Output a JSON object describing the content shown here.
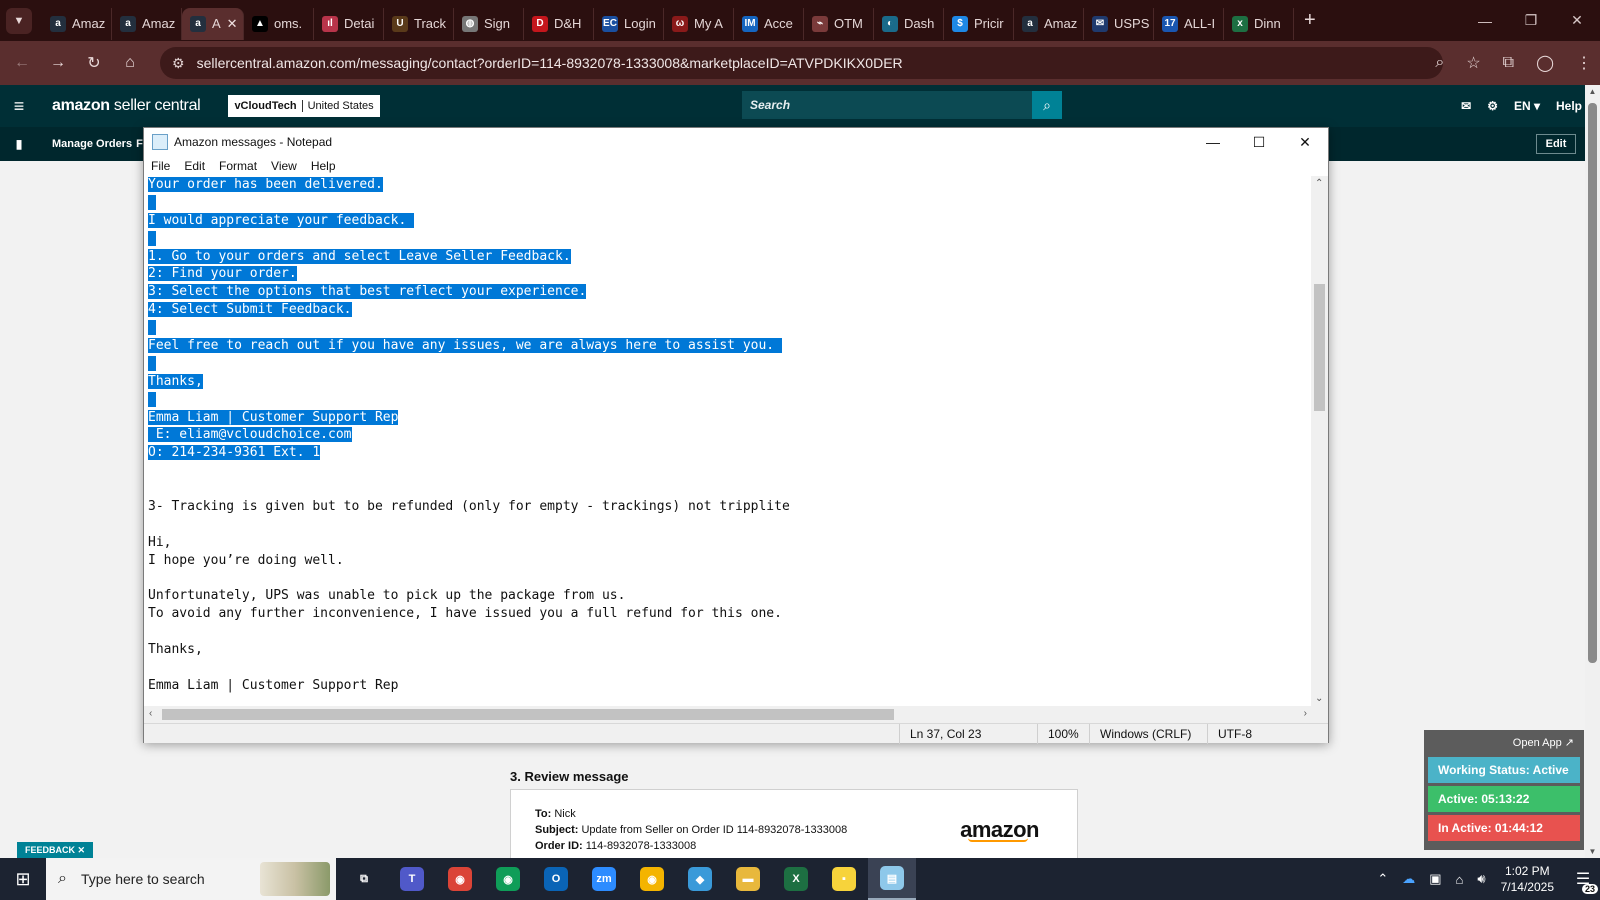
{
  "browser": {
    "tabs": [
      {
        "label": "Amaz",
        "icon": "amazon-icon",
        "color": "#232f3e",
        "glyph": "a"
      },
      {
        "label": "Amaz",
        "icon": "amazon-icon",
        "color": "#232f3e",
        "glyph": "a"
      },
      {
        "label": "A",
        "icon": "amazon-icon",
        "color": "#232f3e",
        "glyph": "a",
        "active": true
      },
      {
        "label": "oms.",
        "icon": "triangle-icon",
        "color": "#000000",
        "glyph": "▲"
      },
      {
        "label": "Detai",
        "icon": "dh-icon",
        "color": "#b8344a",
        "glyph": "ıl"
      },
      {
        "label": "Track",
        "icon": "ups-icon",
        "color": "#5a3a1a",
        "glyph": "U"
      },
      {
        "label": "Sign",
        "icon": "globe-icon",
        "color": "#777777",
        "glyph": "◍"
      },
      {
        "label": "D&H",
        "icon": "dh-logo-icon",
        "color": "#c4161c",
        "glyph": "D"
      },
      {
        "label": "Login",
        "icon": "ec-icon",
        "color": "#1a4fa0",
        "glyph": "EC"
      },
      {
        "label": "My A",
        "icon": "myapp-icon",
        "color": "#8a1a1a",
        "glyph": "ω"
      },
      {
        "label": "Acce",
        "icon": "im-icon",
        "color": "#1565c0",
        "glyph": "IM"
      },
      {
        "label": "OTM",
        "icon": "otm-icon",
        "color": "#7a3a3a",
        "glyph": "⌁"
      },
      {
        "label": "Dash",
        "icon": "dash-icon",
        "color": "#1a6a8a",
        "glyph": "◐"
      },
      {
        "label": "Pricir",
        "icon": "dollar-icon",
        "color": "#1e88e5",
        "glyph": "$"
      },
      {
        "label": "Amaz",
        "icon": "amazon-icon",
        "color": "#232f3e",
        "glyph": "a"
      },
      {
        "label": "USPS",
        "icon": "usps-icon",
        "color": "#1f3a6e",
        "glyph": "✉"
      },
      {
        "label": "ALL-I",
        "icon": "seventeen-icon",
        "color": "#1a56b0",
        "glyph": "17"
      },
      {
        "label": "Dinn",
        "icon": "excel-icon",
        "color": "#1d6f42",
        "glyph": "x"
      }
    ],
    "url": "sellercentral.amazon.com/messaging/contact?orderID=114-8932078-1333008&marketplaceID=ATVPDKIKX0DER"
  },
  "seller_central": {
    "logo_bold": "amazon",
    "logo_light": " seller central",
    "account_name": "vCloudTech",
    "account_region": "United States",
    "search_placeholder": "Search",
    "lang": "EN ▾",
    "help": "Help",
    "nav_manage_orders": "Manage Orders",
    "nav_partial": "F",
    "edit": "Edit"
  },
  "notepad": {
    "title": "Amazon messages - Notepad",
    "menu": [
      "File",
      "Edit",
      "Format",
      "View",
      "Help"
    ],
    "lines": [
      {
        "text": "Your order has been delivered.",
        "sel": true
      },
      {
        "text": " ",
        "sel": true
      },
      {
        "text": "I would appreciate your feedback. ",
        "sel": true
      },
      {
        "text": " ",
        "sel": true
      },
      {
        "text": "1. Go to your orders and select Leave Seller Feedback.",
        "sel": true
      },
      {
        "text": "2: Find your order.",
        "sel": true
      },
      {
        "text": "3: Select the options that best reflect your experience.",
        "sel": true
      },
      {
        "text": "4: Select Submit Feedback.",
        "sel": true
      },
      {
        "text": " ",
        "sel": true
      },
      {
        "text": "Feel free to reach out if you have any issues, we are always here to assist you. ",
        "sel": true
      },
      {
        "text": " ",
        "sel": true
      },
      {
        "text": "Thanks,",
        "sel": true
      },
      {
        "text": " ",
        "sel": true
      },
      {
        "text": "Emma Liam | Customer Support Rep",
        "sel": true
      },
      {
        "text": " E: eliam@vcloudchoice.com",
        "sel": true
      },
      {
        "text": "O: 214-234-9361 Ext. 1",
        "sel": true
      },
      {
        "text": "",
        "sel": false
      },
      {
        "text": "",
        "sel": false
      },
      {
        "text": "3- Tracking is given but to be refunded (only for empty - trackings) not tripplite",
        "sel": false
      },
      {
        "text": "",
        "sel": false
      },
      {
        "text": "Hi,",
        "sel": false
      },
      {
        "text": "I hope you’re doing well.",
        "sel": false
      },
      {
        "text": "",
        "sel": false
      },
      {
        "text": "Unfortunately, UPS was unable to pick up the package from us.",
        "sel": false
      },
      {
        "text": "To avoid any further inconvenience, I have issued you a full refund for this one.",
        "sel": false
      },
      {
        "text": "",
        "sel": false
      },
      {
        "text": "Thanks,",
        "sel": false
      },
      {
        "text": "",
        "sel": false
      },
      {
        "text": "Emma Liam | Customer Support Rep",
        "sel": false
      }
    ],
    "status": {
      "position": "Ln 37, Col 23",
      "zoom": "100%",
      "line_ending": "Windows (CRLF)",
      "encoding": "UTF-8"
    }
  },
  "review": {
    "heading": "3. Review message",
    "to_label": "To:",
    "to_value": " Nick",
    "subject_label": "Subject:",
    "subject_value": " Update from Seller on Order ID 114-8932078-1333008",
    "order_label": "Order ID:",
    "order_value": " 114-8932078-1333008",
    "logo": "amazon"
  },
  "feedback_tab": "FEEDBACK ✕",
  "work_status": {
    "open_app": "Open App ↗",
    "status": "Working Status: Active",
    "active": "Active: 05:13:22",
    "inactive": "In Active: 01:44:12",
    "colors": {
      "status": "#4bb3c8",
      "active": "#3cbf6a",
      "inactive": "#e8524f"
    }
  },
  "taskbar": {
    "search_placeholder": "Type here to search",
    "apps": [
      {
        "name": "task-view-icon",
        "glyph": "⧉",
        "color": "transparent"
      },
      {
        "name": "teams-icon",
        "glyph": "T",
        "color": "#5059c9"
      },
      {
        "name": "chrome-icon",
        "glyph": "◉",
        "color": "#db4437"
      },
      {
        "name": "chrome-profile-icon",
        "glyph": "◉",
        "color": "#0f9d58"
      },
      {
        "name": "outlook-icon",
        "glyph": "O",
        "color": "#0a64b6"
      },
      {
        "name": "zoom-icon",
        "glyph": "zm",
        "color": "#2d8cff"
      },
      {
        "name": "chrome-alt-icon",
        "glyph": "◉",
        "color": "#f4b400"
      },
      {
        "name": "remote-icon",
        "glyph": "◆",
        "color": "#3a9ad9"
      },
      {
        "name": "file-explorer-icon",
        "glyph": "▬",
        "color": "#e8b83c"
      },
      {
        "name": "excel-icon",
        "glyph": "X",
        "color": "#1d6f42"
      },
      {
        "name": "sticky-notes-icon",
        "glyph": "▪",
        "color": "#f7d33b"
      },
      {
        "name": "notepad-icon",
        "glyph": "▤",
        "color": "#8ec8ea",
        "active": true
      }
    ],
    "time": "1:02 PM",
    "date": "7/14/2025",
    "notifications": "23"
  }
}
